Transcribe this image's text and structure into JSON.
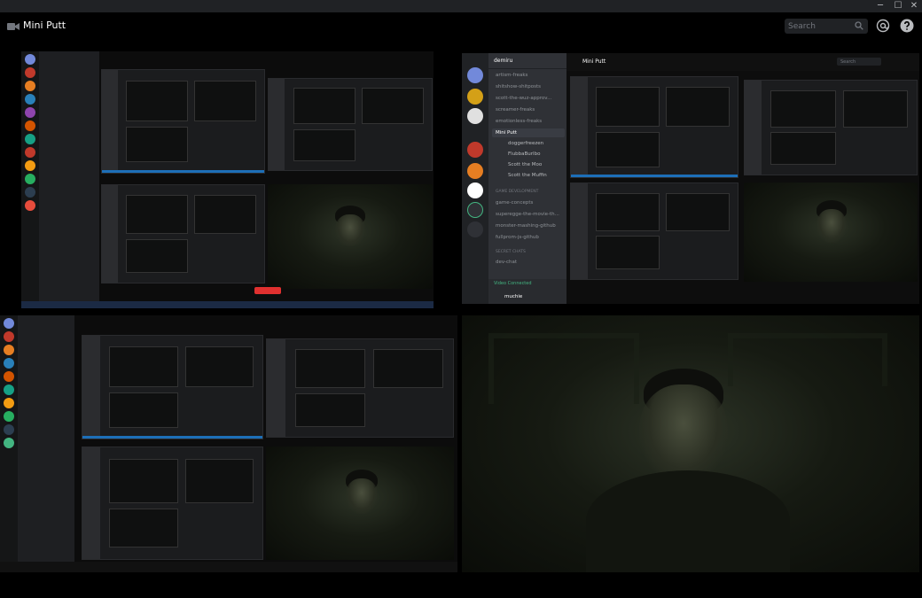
{
  "window": {
    "minimize": "─",
    "maximize": "☐",
    "close": "✕"
  },
  "header": {
    "channel_title": "Mini Putt",
    "search_placeholder": "Search"
  },
  "icons": {
    "camera": "camera-icon",
    "search": "search-icon",
    "mention": "at-icon",
    "help": "help-icon"
  },
  "colors": {
    "background": "#000000",
    "titlebar": "#202225",
    "accent_blue": "#1d6fb8",
    "voice_green": "#43b581"
  },
  "stream_tile_top_right": {
    "server_name": "demiru",
    "header_title": "Mini Putt",
    "search_placeholder": "Search",
    "channels": [
      {
        "label": "artism-freaks",
        "kind": "text"
      },
      {
        "label": "shitshow-shitposts",
        "kind": "text"
      },
      {
        "label": "scott-the-wuz-approv...",
        "kind": "text"
      },
      {
        "label": "screamer-freaks",
        "kind": "text"
      },
      {
        "label": "emotionless-freaks",
        "kind": "text"
      },
      {
        "label": "Mini Putt",
        "kind": "voice-active"
      }
    ],
    "voice_users": [
      "doggerfreezen",
      "FlubbaBurlbo",
      "Scott the Moo",
      "Scott the Muffin"
    ],
    "category_game_dev": "GAME DEVELOPMENT",
    "game_dev_channels": [
      "game-concepts",
      "superegge-the-movie-th...",
      "monster-mashing-github",
      "fullprom-js-github"
    ],
    "category_secret": "SECRET CHATS",
    "secret_channels": [
      "dev-chat"
    ],
    "voice_status": "Video Connected",
    "user_name": "muchie"
  }
}
